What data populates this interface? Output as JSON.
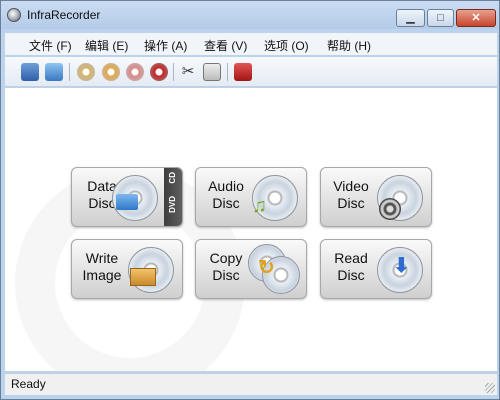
{
  "window": {
    "title": "InfraRecorder"
  },
  "menu": {
    "items": [
      {
        "label": "文件 (F)"
      },
      {
        "label": "编辑 (E)"
      },
      {
        "label": "操作 (A)"
      },
      {
        "label": "查看 (V)"
      },
      {
        "label": "选项 (O)"
      },
      {
        "label": "帮助 (H)"
      }
    ]
  },
  "toolbar": {
    "icons": [
      "save-icon",
      "open-icon",
      "burn-icon",
      "copy-icon",
      "erase-icon",
      "record-icon",
      "cut-icon",
      "print-icon",
      "exit-icon"
    ]
  },
  "actions": [
    {
      "label": "Data\nDisc",
      "icon": "data-disc-icon",
      "badge_top": "CD",
      "badge_bottom": "DVD"
    },
    {
      "label": "Audio\nDisc",
      "icon": "audio-disc-icon"
    },
    {
      "label": "Video\nDisc",
      "icon": "video-disc-icon"
    },
    {
      "label": "Write\nImage",
      "icon": "write-image-icon"
    },
    {
      "label": "Copy\nDisc",
      "icon": "copy-disc-icon"
    },
    {
      "label": "Read\nDisc",
      "icon": "read-disc-icon"
    }
  ],
  "status": {
    "text": "Ready"
  },
  "colors": {
    "titlebar": "#bcd3ee",
    "close_button": "#c7452d",
    "accent": "#2f6ad0"
  }
}
